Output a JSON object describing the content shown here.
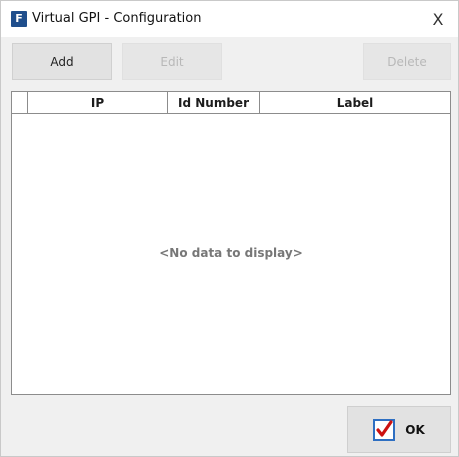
{
  "window": {
    "title": "Virtual GPI - Configuration",
    "app_icon_letter": "F",
    "close_glyph": "X"
  },
  "toolbar": {
    "add_label": "Add",
    "edit_label": "Edit",
    "delete_label": "Delete"
  },
  "grid": {
    "columns": [
      "IP",
      "Id Number",
      "Label"
    ],
    "rows": [],
    "empty_text": "<No data to display>"
  },
  "footer": {
    "ok_label": "OK",
    "ok_icon": "checkmark-icon"
  },
  "colors": {
    "app_icon_bg": "#1f4e8c",
    "check_mark": "#cc1111",
    "check_box_border": "#2e6fc2"
  }
}
